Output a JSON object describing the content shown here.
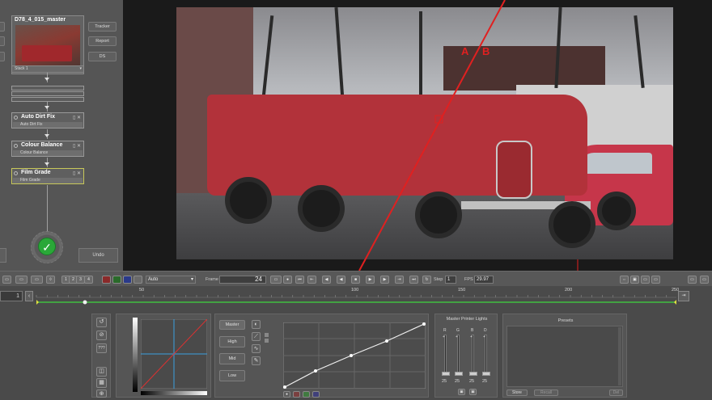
{
  "node_graph": {
    "clip_title": "D78_4_015_master",
    "stack_select": "Stack 1",
    "side_buttons": [
      "Tracker",
      "Report",
      "DS"
    ],
    "nodes": [
      {
        "title": "Auto Dirt Fix",
        "sub": "Auto Dirt Fix",
        "active": false
      },
      {
        "title": "Colour Balance",
        "sub": "Colour Balance",
        "active": false
      },
      {
        "title": "Film Grade",
        "sub": "Film Grade",
        "active": true
      }
    ],
    "undo_label": "Undo"
  },
  "viewer": {
    "wipe_label_a": "A",
    "wipe_label_b": "B",
    "wipe_color": "#e02020"
  },
  "transport": {
    "view_buttons": [
      "1",
      "2",
      "3",
      "4"
    ],
    "mode_select": "Auto",
    "frame_label": "Frame",
    "frame_value": "24",
    "step_label": "Step",
    "step_value": "1",
    "fps_label": "FPS",
    "fps_value": "29.97"
  },
  "timeline": {
    "start_value": "1",
    "tick_labels": [
      "50",
      "100",
      "150",
      "200",
      "250",
      "30"
    ],
    "playhead_frame": 24
  },
  "grade_panel": {
    "range_buttons": [
      "Master",
      "High",
      "Mid",
      "Low"
    ],
    "printer_lights": {
      "title": "Master Printer Lights",
      "columns": [
        {
          "label": "R",
          "value": "25"
        },
        {
          "label": "G",
          "value": "25"
        },
        {
          "label": "B",
          "value": "25"
        },
        {
          "label": "D",
          "value": "25"
        }
      ]
    },
    "presets": {
      "title": "Presets",
      "buttons": [
        "Store",
        "Recall",
        "Del"
      ]
    }
  },
  "colors": {
    "accent_green": "#2aa838",
    "wipe_red": "#e02020",
    "timeline_green": "#3fbf3f"
  }
}
